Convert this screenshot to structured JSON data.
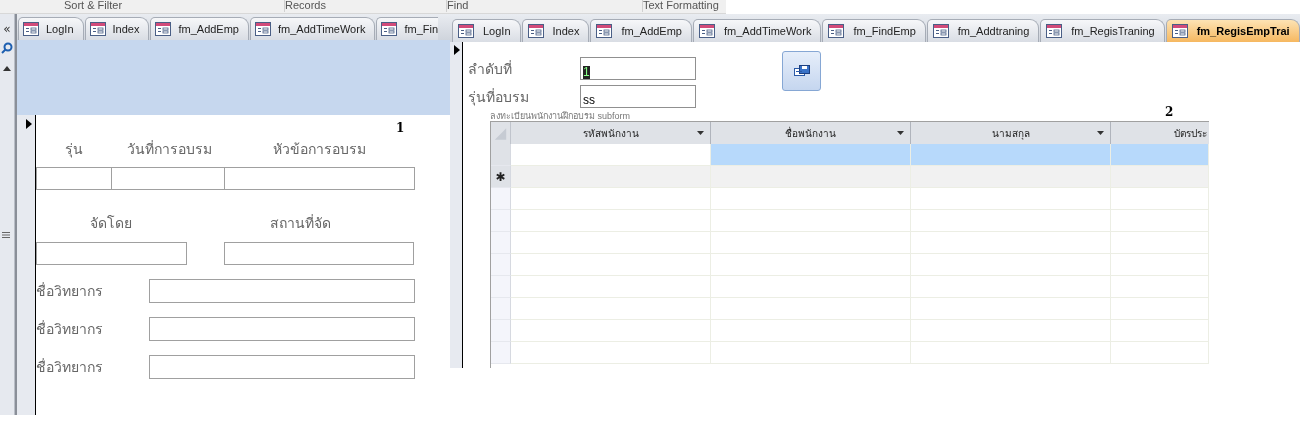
{
  "ribbon": {
    "groups": [
      "Sort & Filter",
      "Records",
      "Find",
      "Text Formatting"
    ]
  },
  "back_window": {
    "nav_toggle": "«",
    "tabs": [
      {
        "label": "LogIn",
        "selected": false
      },
      {
        "label": "Index",
        "selected": false
      },
      {
        "label": "fm_AddEmp",
        "selected": false
      },
      {
        "label": "fm_AddTimeWork",
        "selected": false
      },
      {
        "label": "fm_Fin",
        "selected": false
      }
    ],
    "form": {
      "page_number": "1",
      "top_labels": [
        "รุ่น",
        "วันที่การอบรม",
        "หัวข้อการอบรม"
      ],
      "middle_labels": [
        "จัดโดย",
        "สถานที่จัด"
      ],
      "speaker_labels": [
        "ชื่อวิทยากร",
        "ชื่อวิทยากร",
        "ชื่อวิทยากร"
      ]
    }
  },
  "front_window": {
    "tabs": [
      {
        "label": "LogIn",
        "selected": false
      },
      {
        "label": "Index",
        "selected": false
      },
      {
        "label": "fm_AddEmp",
        "selected": false
      },
      {
        "label": "fm_AddTimeWork",
        "selected": false
      },
      {
        "label": "fm_FindEmp",
        "selected": false
      },
      {
        "label": "fm_Addtraning",
        "selected": false
      },
      {
        "label": "fm_RegisTraning",
        "selected": false
      },
      {
        "label": "fm_RegisEmpTrai",
        "selected": true
      }
    ],
    "form": {
      "page_number": "2",
      "fields": [
        {
          "label": "ลำดับที่",
          "value": "1",
          "selected": true
        },
        {
          "label": "รุ่นที่อบรม",
          "value": "ss",
          "selected": false
        }
      ],
      "subform_label": "ลงทะเบียนพนักงานฝึกอบรม subform",
      "datasheet": {
        "columns": [
          "รหัสพนักงาน",
          "ชื่อพนักงาน",
          "นามสกุล",
          "บัตรประ"
        ],
        "rows": [
          {
            "kind": "record",
            "selected": true
          },
          {
            "kind": "new",
            "marker": "✱",
            "selected": false
          }
        ]
      }
    }
  }
}
